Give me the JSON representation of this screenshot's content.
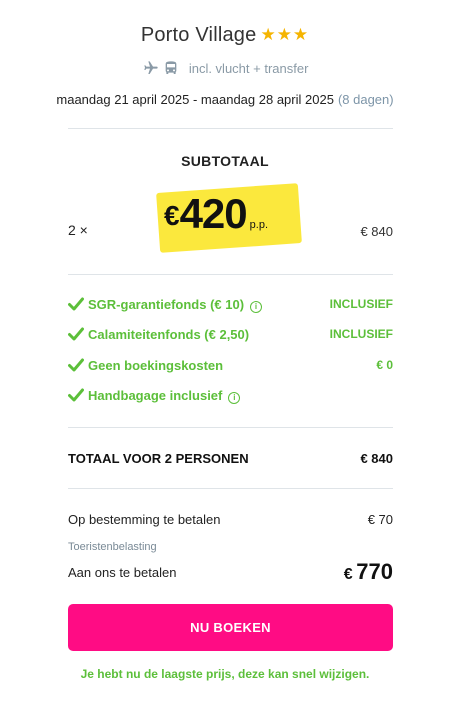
{
  "hotel": {
    "name": "Porto Village",
    "stars": "★★★"
  },
  "transport": {
    "icons": [
      "plane-icon",
      "bus-icon"
    ],
    "label": "incl. vlucht + transfer"
  },
  "dates": {
    "range": "maandag 21 april 2025 - maandag 28 april 2025",
    "duration": "(8 dagen)"
  },
  "subtotal": {
    "label": "SUBTOTAAL",
    "quantity": "2 ×",
    "currency": "€",
    "price": "420",
    "per_person": "p.p.",
    "line_total": "€ 840"
  },
  "fees": [
    {
      "label": "SGR-garantiefonds  (€ 10)",
      "has_info": true,
      "value": "INCLUSIEF"
    },
    {
      "label": "Calamiteitenfonds  (€ 2,50)",
      "has_info": false,
      "value": "INCLUSIEF"
    },
    {
      "label": "Geen boekingskosten",
      "has_info": false,
      "value": "€ 0"
    },
    {
      "label": "Handbagage inclusief",
      "has_info": true,
      "value": ""
    }
  ],
  "total": {
    "label": "TOTAAL VOOR 2 PERSONEN",
    "value": "€ 840"
  },
  "destination": {
    "label": "Op bestemming te betalen",
    "value": "€ 70",
    "note": "Toeristenbelasting"
  },
  "pay": {
    "label": "Aan ons te betalen",
    "currency": "€",
    "amount": "770"
  },
  "cta": {
    "label": "NU BOEKEN"
  },
  "notice": "Je hebt nu de laagste prijs, deze kan snel wijzigen.",
  "colors": {
    "accent_pink": "#ff0c84",
    "success_green": "#5cbf3a",
    "star_gold": "#f5b400",
    "highlight_yellow": "#fbe733"
  }
}
